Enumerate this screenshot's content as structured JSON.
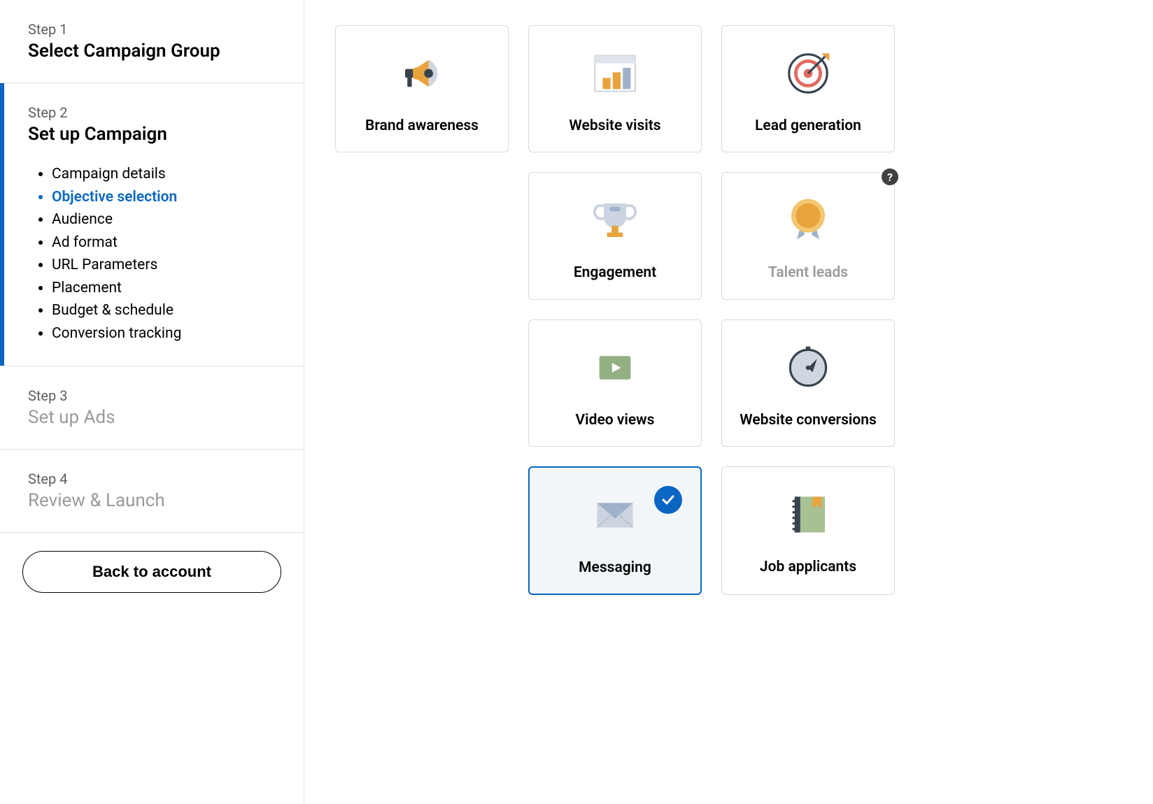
{
  "sidebar": {
    "steps": [
      {
        "num": "Step 1",
        "title": "Select Campaign Group",
        "active": false,
        "muted": false
      },
      {
        "num": "Step 2",
        "title": "Set up Campaign",
        "active": true,
        "muted": false,
        "subs": [
          "Campaign details",
          "Objective selection",
          "Audience",
          "Ad format",
          "URL Parameters",
          "Placement",
          "Budget & schedule",
          "Conversion tracking"
        ],
        "active_sub": "Objective selection"
      },
      {
        "num": "Step 3",
        "title": "Set up Ads",
        "active": false,
        "muted": true
      },
      {
        "num": "Step 4",
        "title": "Review & Launch",
        "active": false,
        "muted": true
      }
    ],
    "back_label": "Back to account"
  },
  "objectives": {
    "brand_awareness": "Brand awareness",
    "website_visits": "Website visits",
    "lead_generation": "Lead generation",
    "engagement": "Engagement",
    "talent_leads": "Talent leads",
    "video_views": "Video views",
    "website_conversions": "Website conversions",
    "messaging": "Messaging",
    "job_applicants": "Job applicants"
  },
  "selected_objective": "messaging",
  "disabled_objectives": [
    "talent_leads"
  ]
}
